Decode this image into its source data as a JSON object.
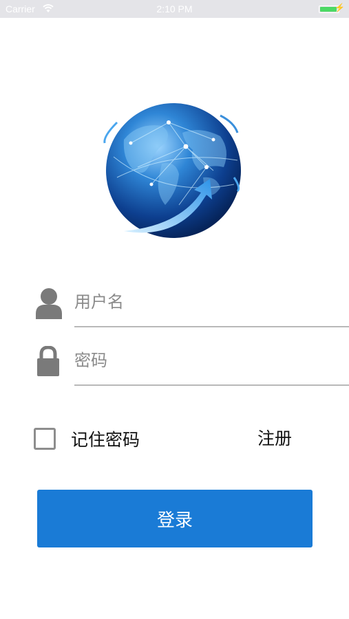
{
  "status_bar": {
    "carrier": "Carrier",
    "time": "2:10 PM",
    "battery_color": "#4cd964"
  },
  "logo": {
    "icon": "globe-icon"
  },
  "login_form": {
    "username": {
      "placeholder": "用户名",
      "value": "",
      "icon": "user-icon"
    },
    "password": {
      "placeholder": "密码",
      "value": "",
      "icon": "lock-icon"
    },
    "remember_label": "记住密码",
    "remember_checked": false,
    "register_label": "注册",
    "login_label": "登录",
    "accent_color": "#1a7bd6"
  }
}
